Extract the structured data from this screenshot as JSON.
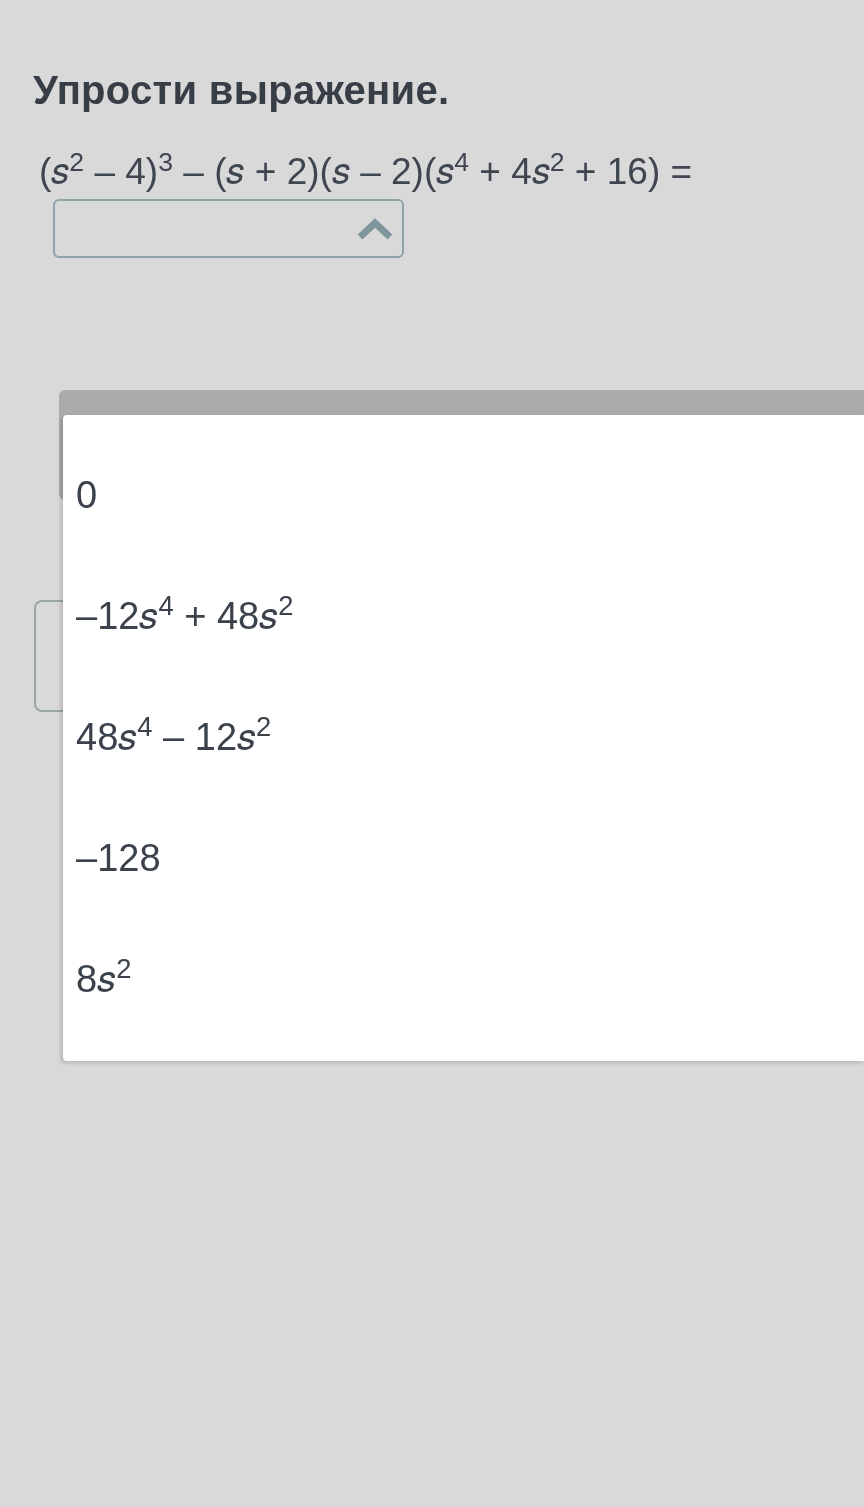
{
  "title": "Упрости выражение.",
  "expression": "(𝑠$^{2}$ – 4)$^{3}$ – (𝑠 + 2)(𝑠 – 2)(𝑠$^{4}$ + 4𝑠$^{2}$ + 16) =",
  "answer_dropdown": {
    "expanded": true,
    "options": [
      {
        "label": "0",
        "selected": false
      },
      {
        "label": "–12𝑠$^{4}$ + 48𝑠$^{2}$",
        "selected": false
      },
      {
        "label": "48𝑠$^{4}$ – 12𝑠$^{2}$",
        "selected": false
      },
      {
        "label": "–128",
        "selected": false
      },
      {
        "label": "8𝑠$^{2}$",
        "selected": false
      }
    ]
  }
}
